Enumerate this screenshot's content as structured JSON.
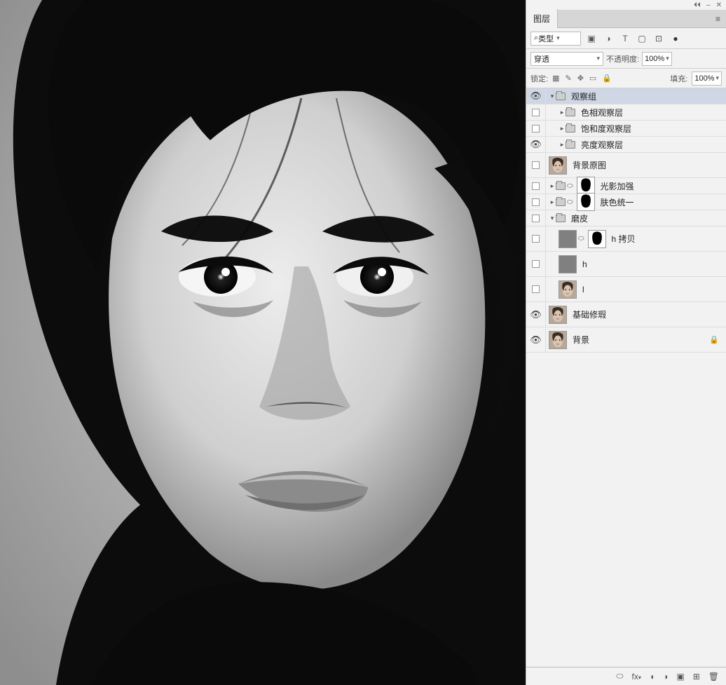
{
  "window_controls": {
    "collapse": "⏴⏴",
    "minimize": "–",
    "close": "✕"
  },
  "panel_tab": "图层",
  "filter": {
    "type_label": "类型",
    "icons": {
      "image": "▣",
      "adjust": "◑",
      "text": "T",
      "shape": "▢",
      "smart": "⊡",
      "dot": "●"
    }
  },
  "blend": {
    "mode": "穿透",
    "opacity_label": "不透明度:",
    "opacity": "100%",
    "fill_label": "填充:",
    "fill": "100%"
  },
  "lock": {
    "label": "锁定:",
    "icons": {
      "pixels": "▦",
      "brush": "✎",
      "move": "✥",
      "artboard": "▭",
      "all": "🔒"
    }
  },
  "layers": [
    {
      "type": "group",
      "vis": "eye",
      "disclose": "down",
      "indent": 0,
      "name": "观察组",
      "selected": true
    },
    {
      "type": "group",
      "vis": "box",
      "disclose": "right",
      "indent": 1,
      "name": "色相观察层"
    },
    {
      "type": "group",
      "vis": "box",
      "disclose": "right",
      "indent": 1,
      "name": "饱和度观察层"
    },
    {
      "type": "group",
      "vis": "eye",
      "disclose": "right",
      "indent": 1,
      "name": "亮度观察层"
    },
    {
      "type": "image",
      "vis": "box",
      "indent": 0,
      "name": "背景原图",
      "thumb": "face"
    },
    {
      "type": "group-mask",
      "vis": "box",
      "disclose": "right",
      "indent": 0,
      "name": "光影加强",
      "mask": "silhouette"
    },
    {
      "type": "group-mask",
      "vis": "box",
      "disclose": "right",
      "indent": 0,
      "name": "肤色统一",
      "mask": "silhouette"
    },
    {
      "type": "group",
      "vis": "box",
      "disclose": "down",
      "indent": 0,
      "name": "磨皮"
    },
    {
      "type": "gray-mask",
      "vis": "box",
      "indent": 1,
      "name": "h 拷贝",
      "mask": "silhouette"
    },
    {
      "type": "gray",
      "vis": "box",
      "indent": 1,
      "name": "h"
    },
    {
      "type": "image",
      "vis": "box",
      "indent": 1,
      "name": "l",
      "thumb": "face"
    },
    {
      "type": "image",
      "vis": "eye",
      "indent": 0,
      "name": "基础修瑕",
      "thumb": "face"
    },
    {
      "type": "image",
      "vis": "eye",
      "indent": 0,
      "name": "背景",
      "thumb": "face",
      "locked": true
    }
  ],
  "footer_icons": {
    "link": "⬭",
    "fx": "fx",
    "mask": "◖",
    "adjust": "◑",
    "group": "▣",
    "new": "⊞",
    "trash": "🗑"
  }
}
